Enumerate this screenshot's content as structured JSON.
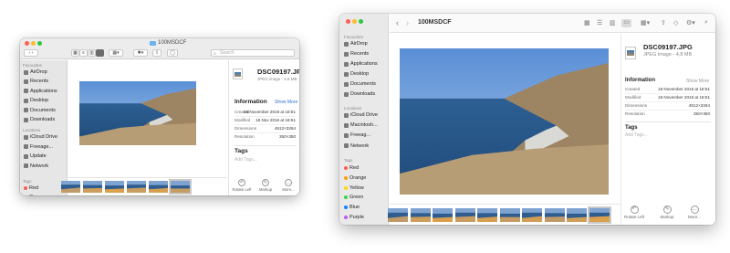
{
  "colors": {
    "close": "#fe5f57",
    "minimize": "#febc2e",
    "zoom": "#28c840",
    "accent_blue": "#2f72d6"
  },
  "window_a": {
    "title": "100MSDCF",
    "search_placeholder": "Search",
    "sidebar": {
      "favourites_header": "Favourites",
      "favourites": [
        {
          "label": "AirDrop",
          "icon": "airdrop-icon"
        },
        {
          "label": "Recents",
          "icon": "clock-icon"
        },
        {
          "label": "Applications",
          "icon": "applications-icon"
        },
        {
          "label": "Desktop",
          "icon": "desktop-icon"
        },
        {
          "label": "Documents",
          "icon": "document-icon"
        },
        {
          "label": "Downloads",
          "icon": "download-icon"
        }
      ],
      "locations_header": "Locations",
      "locations": [
        {
          "label": "iCloud Drive",
          "icon": "cloud-icon"
        },
        {
          "label": "Freeage...",
          "icon": "disk-icon"
        },
        {
          "label": "Update",
          "icon": "disk-icon"
        },
        {
          "label": "Network",
          "icon": "network-icon"
        }
      ],
      "tags_header": "Tags",
      "tags": [
        {
          "label": "Red",
          "color": "#ff5a52"
        },
        {
          "label": "Orange",
          "color": "#ff9f0a"
        }
      ]
    },
    "info": {
      "file_name": "DSC09197.JPG",
      "file_sub": "JPEG image - 4.8 MB",
      "section": "Information",
      "show_more": "Show More",
      "rows": [
        {
          "label": "Created",
          "value": "18 November 2016 at 18:51"
        },
        {
          "label": "Modified",
          "value": "18 Nov 2016 at 18:51"
        },
        {
          "label": "Dimensions",
          "value": "4912×3264"
        },
        {
          "label": "Resolution",
          "value": "350×350"
        }
      ],
      "tags_title": "Tags",
      "add_tags": "Add Tags...",
      "actions": [
        {
          "label": "Rotate Left",
          "icon": "rotate-left-icon",
          "glyph": "↶"
        },
        {
          "label": "Markup",
          "icon": "markup-icon",
          "glyph": "✎"
        },
        {
          "label": "More...",
          "icon": "more-icon",
          "glyph": "…"
        }
      ]
    }
  },
  "window_b": {
    "title": "100MSDCF",
    "sidebar": {
      "favourites_header": "Favourites",
      "favourites": [
        {
          "label": "AirDrop",
          "icon": "airdrop-icon"
        },
        {
          "label": "Recents",
          "icon": "clock-icon"
        },
        {
          "label": "Applications",
          "icon": "applications-icon"
        },
        {
          "label": "Desktop",
          "icon": "desktop-icon"
        },
        {
          "label": "Documents",
          "icon": "document-icon"
        },
        {
          "label": "Downloads",
          "icon": "download-icon"
        }
      ],
      "locations_header": "Locations",
      "locations": [
        {
          "label": "iCloud Drive",
          "icon": "cloud-icon"
        },
        {
          "label": "Macintosh...",
          "icon": "disk-icon"
        },
        {
          "label": "Freeag...",
          "icon": "disk-icon"
        },
        {
          "label": "Network",
          "icon": "network-icon"
        }
      ],
      "tags_header": "Tags",
      "tags": [
        {
          "label": "Red",
          "color": "#ff5a52"
        },
        {
          "label": "Orange",
          "color": "#ff9f0a"
        },
        {
          "label": "Yellow",
          "color": "#ffd60a"
        },
        {
          "label": "Green",
          "color": "#32d74b"
        },
        {
          "label": "Blue",
          "color": "#0a84ff"
        },
        {
          "label": "Purple",
          "color": "#bf5af2"
        }
      ]
    },
    "info": {
      "file_name": "DSC09197.JPG",
      "file_sub": "JPEG image - 4,8 MB",
      "section": "Information",
      "show_more": "Show More",
      "rows": [
        {
          "label": "Created",
          "value": "18 November 2016 at 18:51"
        },
        {
          "label": "Modified",
          "value": "18 November 2016 at 18:51"
        },
        {
          "label": "Dimensions",
          "value": "4912×3264"
        },
        {
          "label": "Resolution",
          "value": "350×350"
        }
      ],
      "tags_title": "Tags",
      "add_tags": "Add Tags...",
      "actions": [
        {
          "label": "Rotate Left",
          "icon": "rotate-left-icon",
          "glyph": "↶"
        },
        {
          "label": "Markup",
          "icon": "markup-icon",
          "glyph": "✎"
        },
        {
          "label": "More...",
          "icon": "more-icon",
          "glyph": "…"
        }
      ]
    }
  }
}
